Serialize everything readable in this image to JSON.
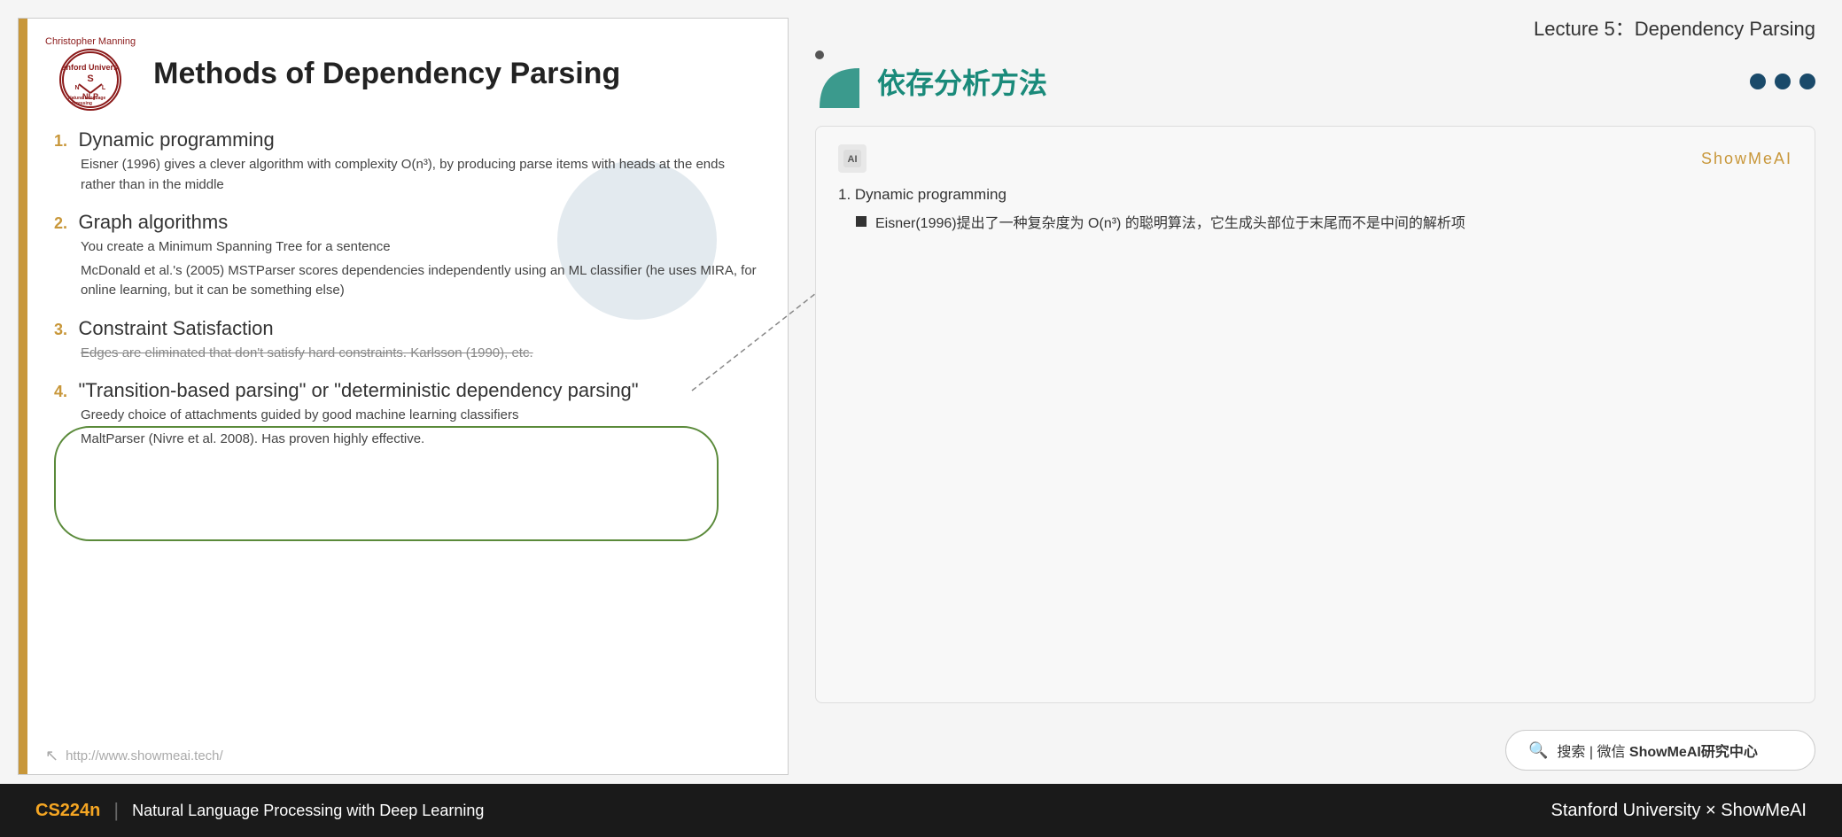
{
  "lecture_title": "Lecture 5：Dependency Parsing",
  "slide": {
    "author": "Christopher Manning",
    "title": "Methods of Dependency Parsing",
    "methods": [
      {
        "number": "1.",
        "heading": "Dynamic programming",
        "desc": "Eisner (1996) gives a clever algorithm with complexity O(n³), by producing parse items with heads at the ends rather than in the middle"
      },
      {
        "number": "2.",
        "heading": "Graph algorithms",
        "desc1": "You create a Minimum Spanning Tree for a sentence",
        "desc2": "McDonald et al.'s (2005) MSTParser scores dependencies independently using an ML classifier (he uses MIRA, for online learning, but it can be something else)"
      },
      {
        "number": "3.",
        "heading": "Constraint Satisfaction",
        "desc": "Edges are eliminated that don't satisfy hard constraints. Karlsson (1990), etc."
      },
      {
        "number": "4.",
        "heading": "\"Transition-based parsing\" or \"deterministic dependency parsing\"",
        "desc1": "Greedy choice of attachments guided by good machine learning classifiers",
        "desc2": "MaltParser (Nivre et al. 2008). Has proven highly effective."
      }
    ],
    "footer_url": "http://www.showmeai.tech/"
  },
  "right_panel": {
    "dot_top": "•",
    "section_title_cn": "依存分析方法",
    "ai_card": {
      "ai_icon": "A↑",
      "brand": "ShowMeAI",
      "item1_label": "1.  Dynamic programming",
      "bullet1": "Eisner(1996)提出了一种复杂度为 O(n³) 的聪明算法，它生成头部位于末尾而不是中间的解析项"
    },
    "search_bar": {
      "icon": "🔍",
      "divider": "|",
      "text": "搜索 | 微信 ShowMeAI研究中心"
    }
  },
  "bottom_bar": {
    "course": "CS224n",
    "divider": "|",
    "description": "Natural Language Processing with Deep Learning",
    "right": "Stanford University  ×  ShowMeAI"
  }
}
